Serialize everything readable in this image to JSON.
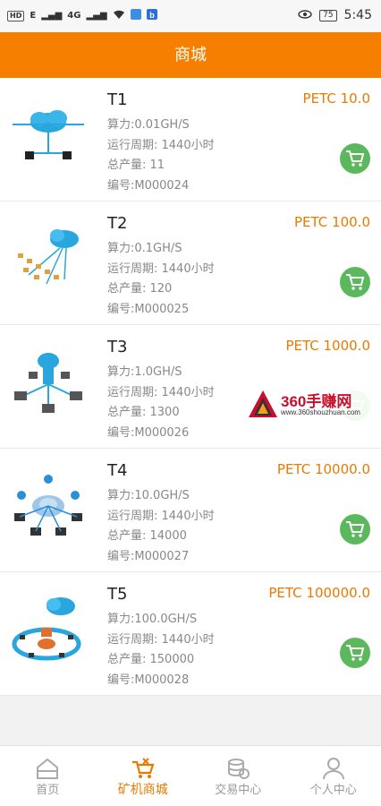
{
  "status_bar": {
    "left_labels": [
      "HD",
      "E",
      "4G",
      "4G"
    ],
    "battery": "75",
    "time": "5:45"
  },
  "header": {
    "title": "商城"
  },
  "products": [
    {
      "name": "T1",
      "price": "PETC  10.0",
      "hashrate": "算力:0.01GH/S",
      "period": "运行周期: 1440小时",
      "total": "总产量:  11",
      "code": "编号:M000024"
    },
    {
      "name": "T2",
      "price": "PETC  100.0",
      "hashrate": "算力:0.1GH/S",
      "period": "运行周期: 1440小时",
      "total": "总产量:  120",
      "code": "编号:M000025"
    },
    {
      "name": "T3",
      "price": "PETC  1000.0",
      "hashrate": "算力:1.0GH/S",
      "period": "运行周期: 1440小时",
      "total": "总产量:  1300",
      "code": "编号:M000026"
    },
    {
      "name": "T4",
      "price": "PETC  10000.0",
      "hashrate": "算力:10.0GH/S",
      "period": "运行周期: 1440小时",
      "total": "总产量:  14000",
      "code": "编号:M000027"
    },
    {
      "name": "T5",
      "price": "PETC  100000.0",
      "hashrate": "算力:100.0GH/S",
      "period": "运行周期: 1440小时",
      "total": "总产量:  150000",
      "code": "编号:M000028"
    }
  ],
  "watermark": {
    "title": "360手赚网",
    "url": "www.360shouzhuan.com"
  },
  "bottom_nav": [
    {
      "label": "首页",
      "icon": "home-icon",
      "active": false
    },
    {
      "label": "矿机商城",
      "icon": "miner-cart-icon",
      "active": true
    },
    {
      "label": "交易中心",
      "icon": "coins-icon",
      "active": false
    },
    {
      "label": "个人中心",
      "icon": "user-icon",
      "active": false
    }
  ],
  "colors": {
    "brand": "#f77f00",
    "price": "#e97a00",
    "cart": "#5cb85c",
    "inactive": "#999999"
  }
}
